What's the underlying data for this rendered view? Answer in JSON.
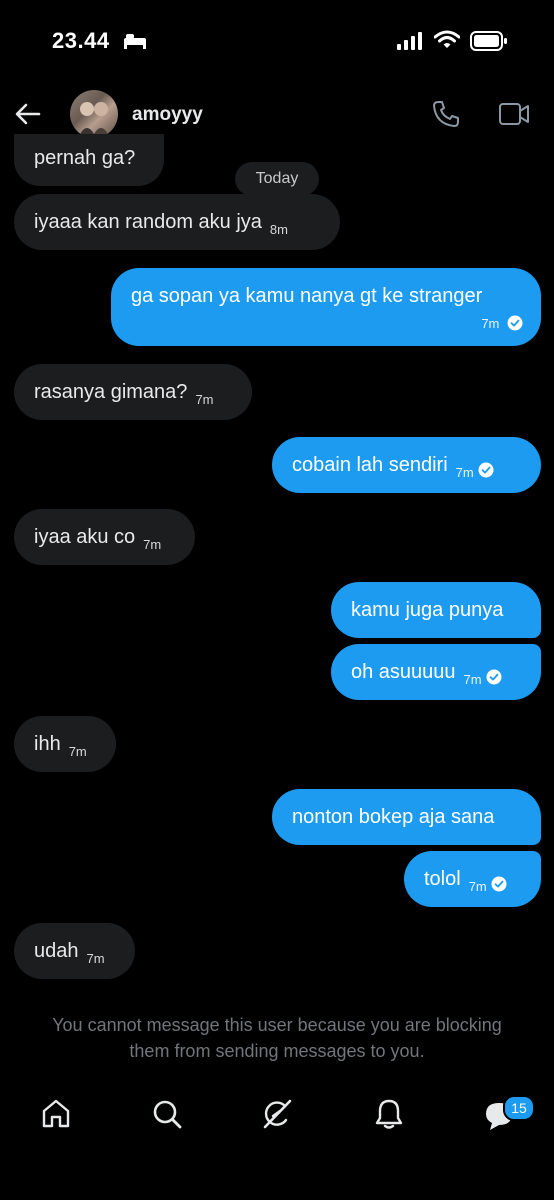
{
  "status_bar": {
    "time": "23.44"
  },
  "header": {
    "username": "amoyyy"
  },
  "date_divider": "Today",
  "messages": [
    {
      "text": "pernah ga?",
      "time": "",
      "dir": "in"
    },
    {
      "text": "iyaaa kan random aku jya",
      "time": "8m",
      "dir": "in"
    },
    {
      "text": "ga sopan ya kamu nanya gt ke stranger",
      "time": "7m",
      "dir": "out"
    },
    {
      "text": "rasanya gimana?",
      "time": "7m",
      "dir": "in"
    },
    {
      "text": "cobain lah sendiri",
      "time": "7m",
      "dir": "out"
    },
    {
      "text": "iyaa aku co",
      "time": "7m",
      "dir": "in"
    },
    {
      "text": "kamu juga punya",
      "time": "",
      "dir": "out"
    },
    {
      "text": "oh asuuuuu",
      "time": "7m",
      "dir": "out"
    },
    {
      "text": "ihh",
      "time": "7m",
      "dir": "in"
    },
    {
      "text": "nonton bokep aja sana",
      "time": "",
      "dir": "out"
    },
    {
      "text": "tolol",
      "time": "7m",
      "dir": "out"
    },
    {
      "text": "udah",
      "time": "7m",
      "dir": "in"
    }
  ],
  "notice": "You cannot message this user because you are blocking them from sending messages to you.",
  "bottom_nav": {
    "items": [
      "home-icon",
      "search-icon",
      "grok-icon",
      "notifications-icon",
      "messages-icon"
    ],
    "messages_badge": "15"
  },
  "colors": {
    "accent": "#1d9bf0",
    "incoming_bubble": "#1c1d1f",
    "background": "#000000",
    "muted": "#71767b"
  }
}
